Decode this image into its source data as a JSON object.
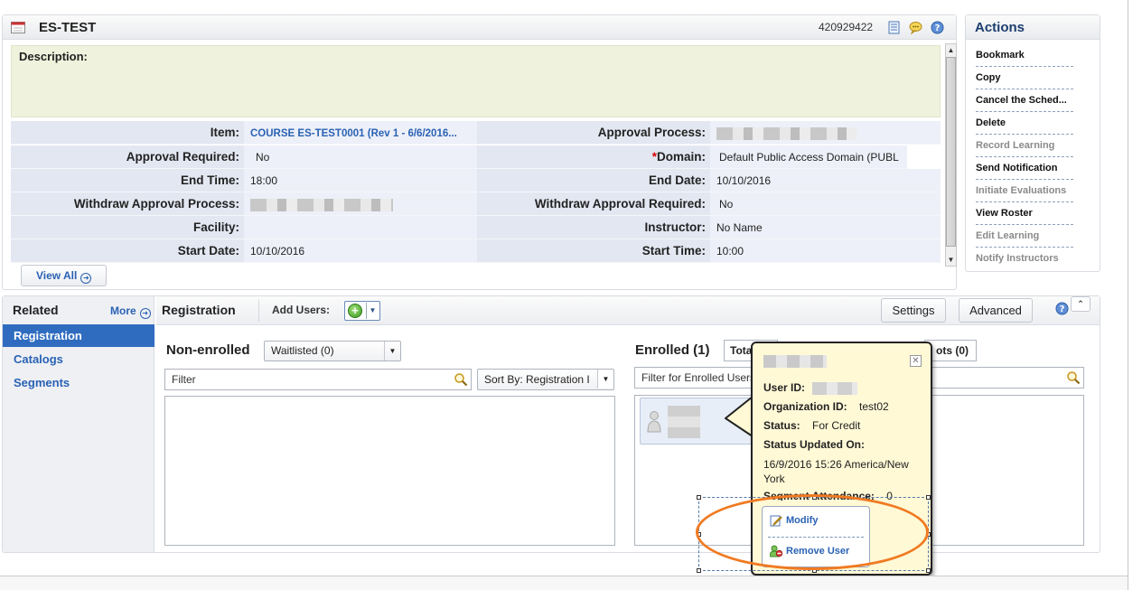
{
  "course": {
    "title": "ES-TEST",
    "record_id": "420929422",
    "description_label": "Description:",
    "view_all_label": "View All"
  },
  "details": {
    "item_label": "Item:",
    "item_value": "COURSE ES-TEST0001 (Rev 1 - 6/6/2016...",
    "approval_process_label": "Approval Process:",
    "approval_required_label": "Approval Required:",
    "approval_required_value": "No",
    "domain_required_mark": "*",
    "domain_label": "Domain:",
    "domain_value": "Default Public Access Domain (PUBL",
    "end_time_label": "End Time:",
    "end_time_value": "18:00",
    "end_date_label": "End Date:",
    "end_date_value": "10/10/2016",
    "withdraw_process_label": "Withdraw Approval Process:",
    "withdraw_required_label": "Withdraw Approval Required:",
    "withdraw_required_value": "No",
    "facility_label": "Facility:",
    "facility_value": "",
    "instructor_label": "Instructor:",
    "instructor_value": "No Name",
    "start_date_label": "Start Date:",
    "start_date_value": "10/10/2016",
    "start_time_label": "Start Time:",
    "start_time_value": "10:00"
  },
  "actions": {
    "title": "Actions",
    "items": [
      {
        "label": "Bookmark",
        "enabled": true
      },
      {
        "label": "Copy",
        "enabled": true
      },
      {
        "label": "Cancel the Sched...",
        "enabled": true
      },
      {
        "label": "Delete",
        "enabled": true
      },
      {
        "label": "Record Learning",
        "enabled": false
      },
      {
        "label": "Send Notification",
        "enabled": true
      },
      {
        "label": "Initiate Evaluations",
        "enabled": false
      },
      {
        "label": "View Roster",
        "enabled": true
      },
      {
        "label": "Edit Learning",
        "enabled": false
      },
      {
        "label": "Notify Instructors",
        "enabled": false
      }
    ]
  },
  "related": {
    "title": "Related",
    "more_label": "More",
    "items": [
      "Registration",
      "Catalogs",
      "Segments"
    ],
    "active_index": 0
  },
  "registration": {
    "title": "Registration",
    "add_users_label": "Add Users:",
    "settings_label": "Settings",
    "advanced_label": "Advanced",
    "non_enrolled_title": "Non-enrolled",
    "waitlist_select": "Waitlisted (0)",
    "filter_placeholder": "Filter",
    "sort_select": "Sort By: Registration I",
    "enrolled_title": "Enrolled (1)",
    "total_label": "Tota",
    "slots_label": "ots (0)",
    "enrolled_filter_placeholder": "Filter for Enrolled Users"
  },
  "popup": {
    "user_id_label": "User ID:",
    "org_id_label": "Organization ID:",
    "org_id_value": "test02",
    "status_label": "Status:",
    "status_value": "For Credit",
    "status_updated_label": "Status Updated On:",
    "status_updated_value": "16/9/2016 15:26 America/New York",
    "segment_attendance_label": "Segment Attendance:",
    "segment_attendance_value": "0",
    "close_symbol": "✕",
    "modify_label": "Modify",
    "remove_label": "Remove User"
  }
}
